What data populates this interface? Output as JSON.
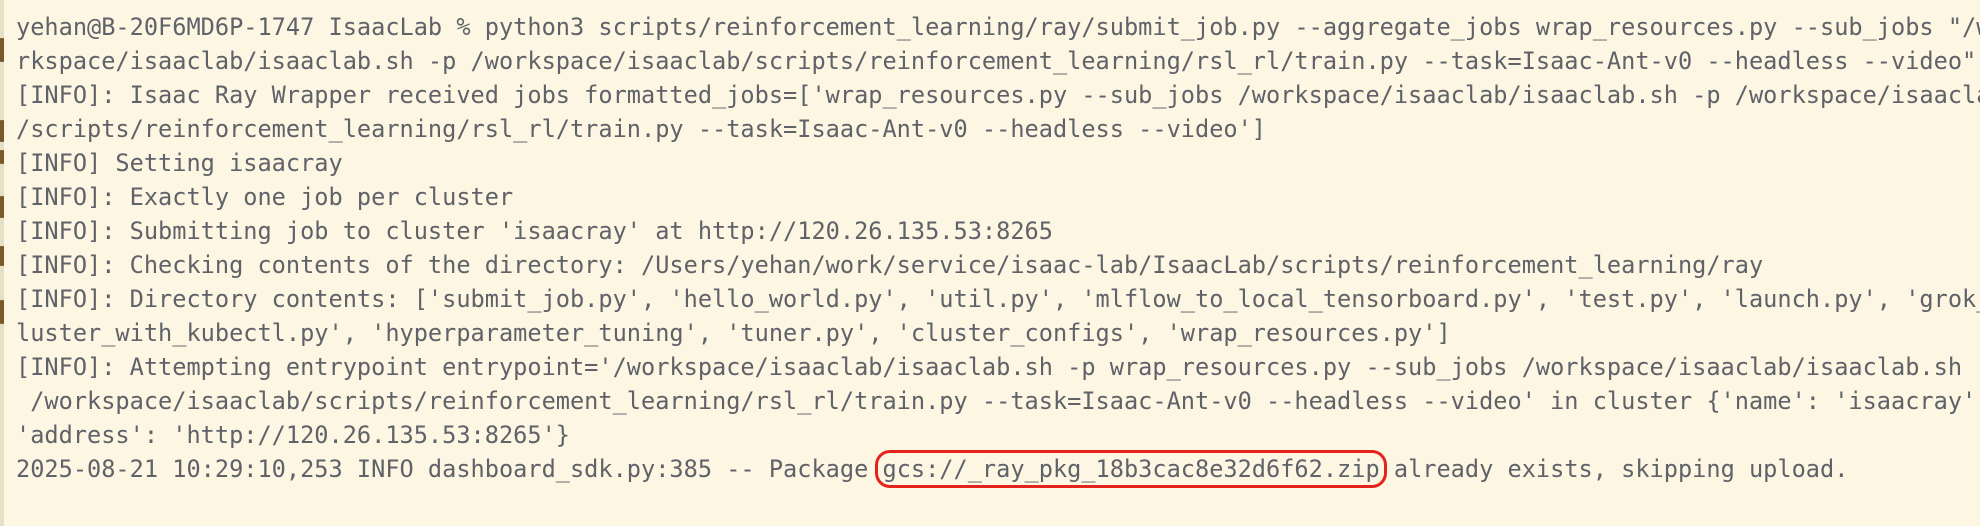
{
  "terminal": {
    "lines": [
      "yehan@B-20F6MD6P-1747 IsaacLab % python3 scripts/reinforcement_learning/ray/submit_job.py --aggregate_jobs wrap_resources.py --sub_jobs \"/wo",
      "rkspace/isaaclab/isaaclab.sh -p /workspace/isaaclab/scripts/reinforcement_learning/rsl_rl/train.py --task=Isaac-Ant-v0 --headless --video\"",
      "[INFO]: Isaac Ray Wrapper received jobs formatted_jobs=['wrap_resources.py --sub_jobs /workspace/isaaclab/isaaclab.sh -p /workspace/isaaclab",
      "/scripts/reinforcement_learning/rsl_rl/train.py --task=Isaac-Ant-v0 --headless --video']",
      "[INFO] Setting isaacray",
      "[INFO]: Exactly one job per cluster",
      "[INFO]: Submitting job to cluster 'isaacray' at http://120.26.135.53:8265",
      "[INFO]: Checking contents of the directory: /Users/yehan/work/service/isaac-lab/IsaacLab/scripts/reinforcement_learning/ray",
      "[INFO]: Directory contents: ['submit_job.py', 'hello_world.py', 'util.py', 'mlflow_to_local_tensorboard.py', 'test.py', 'launch.py', 'grok_c",
      "luster_with_kubectl.py', 'hyperparameter_tuning', 'tuner.py', 'cluster_configs', 'wrap_resources.py']",
      "[INFO]: Attempting entrypoint entrypoint='/workspace/isaaclab/isaaclab.sh -p wrap_resources.py --sub_jobs /workspace/isaaclab/isaaclab.sh -p",
      " /workspace/isaaclab/scripts/reinforcement_learning/rsl_rl/train.py --task=Isaac-Ant-v0 --headless --video' in cluster {'name': 'isaacray',",
      "'address': 'http://120.26.135.53:8265'}"
    ],
    "last_line": {
      "prefix": "2025-08-21 10:29:10,253 INFO dashboard_sdk.py:385 -- Package ",
      "highlighted": "gcs://_ray_pkg_18b3cac8e32d6f62.zip",
      "suffix": " already exists, skipping upload."
    }
  },
  "colors": {
    "background": "#fdf6e3",
    "text": "#5f6268",
    "highlight_border": "#e3231c"
  }
}
